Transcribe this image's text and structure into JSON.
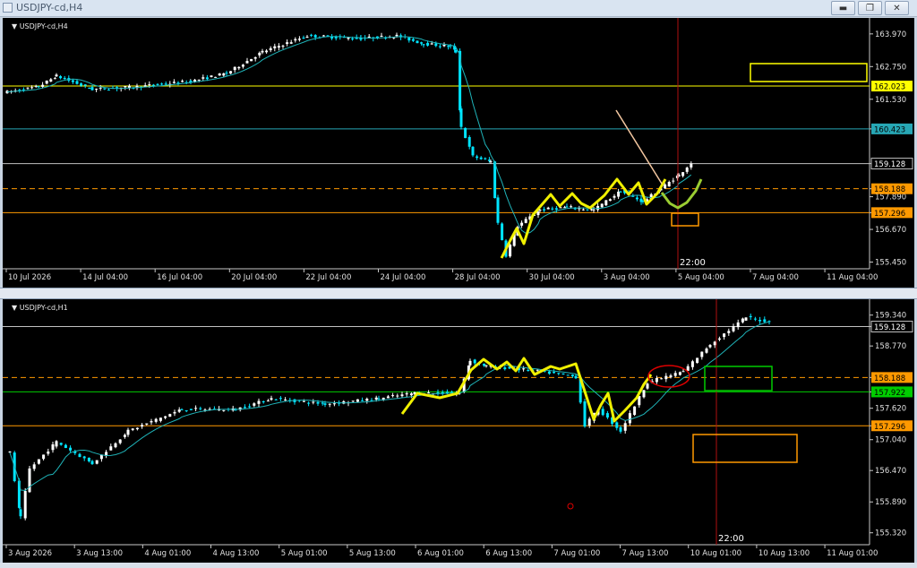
{
  "window": {
    "title": "USDJPY-cd,H4"
  },
  "controls": {
    "minimize": "▬",
    "restore": "❐",
    "close": "✕"
  },
  "colors": {
    "background": "#000000",
    "bull": "#ffffff",
    "bear": "#00e5ff",
    "ma": "#1fb3b8",
    "yellow": "#ffff00",
    "orange": "#ff9900",
    "green": "#00cc00",
    "red": "#dd0000",
    "cyan_line": "#27a7b5"
  },
  "chart_data": [
    {
      "type": "candlestick",
      "title": "USDJPY-cd,H4",
      "price_ticks": [
        "163.970",
        "162.750",
        "161.530",
        "160.423",
        "159.128",
        "158.188",
        "157.890",
        "157.296",
        "156.670",
        "155.450"
      ],
      "time_ticks": [
        "10 Jul 2026",
        "14 Jul 04:00",
        "16 Jul 04:00",
        "20 Jul 04:00",
        "22 Jul 04:00",
        "24 Jul 04:00",
        "28 Jul 04:00",
        "30 Jul 04:00",
        "3 Aug 04:00",
        "5 Aug 04:00",
        "7 Aug 04:00",
        "11 Aug 04:00"
      ],
      "level_labels": [
        {
          "label": "162.023",
          "color": "yellow"
        },
        {
          "label": "160.423",
          "color": "cyan"
        },
        {
          "label": "159.128",
          "color": "gray"
        },
        {
          "label": "158.188",
          "color": "orange"
        },
        {
          "label": "157.296",
          "color": "orange"
        }
      ],
      "vertical_marker": "22:00",
      "ylim": [
        155.2,
        164.5
      ]
    },
    {
      "type": "candlestick",
      "title": "USDJPY-cd,H1",
      "price_ticks": [
        "159.340",
        "159.128",
        "158.770",
        "158.188",
        "157.922",
        "157.620",
        "157.296",
        "157.040",
        "156.470",
        "155.890",
        "155.320"
      ],
      "time_ticks": [
        "3 Aug 2026",
        "3 Aug 13:00",
        "4 Aug 01:00",
        "4 Aug 13:00",
        "5 Aug 01:00",
        "5 Aug 13:00",
        "6 Aug 01:00",
        "6 Aug 13:00",
        "7 Aug 01:00",
        "7 Aug 13:00",
        "10 Aug 01:00",
        "10 Aug 13:00",
        "11 Aug 01:00"
      ],
      "level_labels": [
        {
          "label": "159.128",
          "color": "gray"
        },
        {
          "label": "158.188",
          "color": "orange"
        },
        {
          "label": "157.922",
          "color": "green"
        },
        {
          "label": "157.296",
          "color": "orange"
        }
      ],
      "vertical_marker": "22:00",
      "ylim": [
        155.1,
        159.6
      ]
    }
  ]
}
